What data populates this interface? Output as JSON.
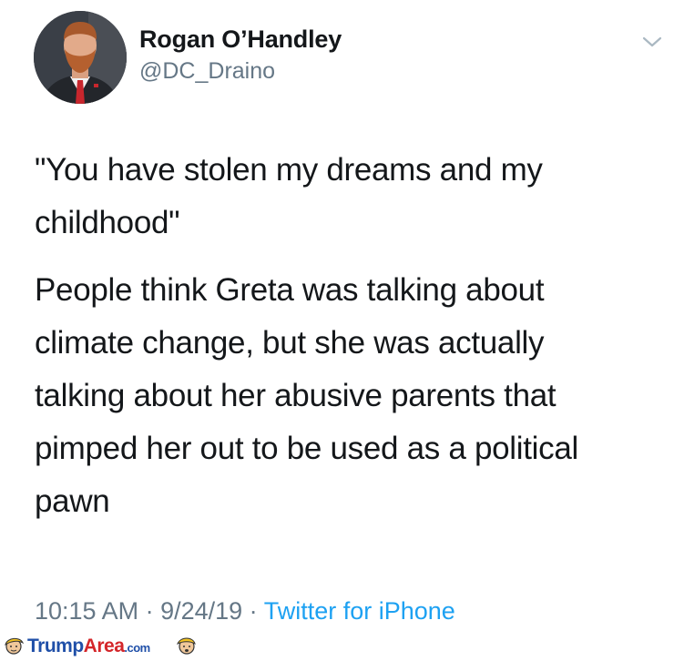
{
  "author": {
    "display_name": "Rogan O’Handley",
    "handle": "@DC_Draino"
  },
  "icons": {
    "avatar": "profile-photo",
    "menu": "chevron-down-icon"
  },
  "tweet": {
    "paragraphs": [
      "\"You have stolen my dreams and my\nchildhood\"",
      "People think Greta was talking about\nclimate change, but she was actually\ntalking about her abusive parents that\npimped her out to be used as a political\npawn"
    ]
  },
  "meta": {
    "time": "10:15 AM",
    "separator": " · ",
    "date": "9/24/19",
    "source": "Twitter for iPhone"
  },
  "watermark": {
    "brand_part1": "Trump",
    "brand_part2": "Area",
    "brand_suffix": ".com"
  },
  "colors": {
    "text": "#14171a",
    "secondary": "#657786",
    "link": "#1da1f2"
  }
}
